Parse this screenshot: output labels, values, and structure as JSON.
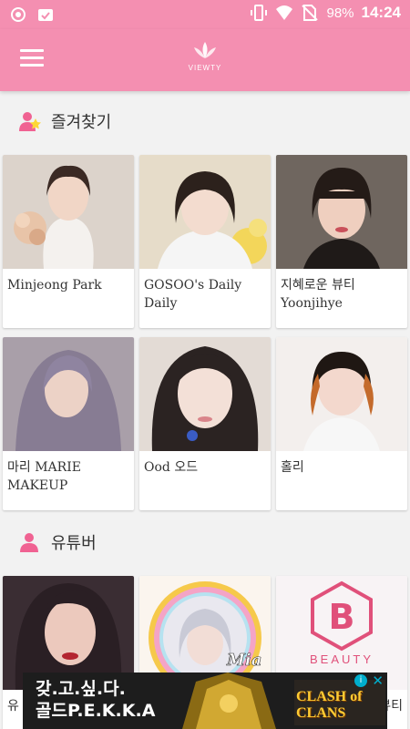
{
  "status_bar": {
    "battery_percent": "98%",
    "time": "14:24"
  },
  "app_bar": {
    "logo_text": "VIEWTY"
  },
  "favorites": {
    "title": "즐겨찾기",
    "items": [
      {
        "name": "Minjeong Park",
        "color": "#c8b6a6"
      },
      {
        "name": "GOSOO's Daily Daily",
        "color": "#b7a28d"
      },
      {
        "name": "지혜로운 뷰티 Yoonjihye",
        "color": "#8d8075"
      },
      {
        "name": "마리 MARIE MAKEUP",
        "color": "#8b8295"
      },
      {
        "name": "Ood 오드",
        "color": "#d8cfc9"
      },
      {
        "name": "홀리",
        "color": "#cfc3bd"
      }
    ]
  },
  "youtubers": {
    "title": "유튜버",
    "items": [
      {
        "name": "유",
        "color": "#3a2d33"
      },
      {
        "name": "",
        "color": "#f4e8d8"
      },
      {
        "name": "뷰티",
        "color": "#f7f2f4"
      }
    ],
    "beauty_logo_letter": "B",
    "beauty_logo_text": "BEAUTY",
    "mia_text": "Mia"
  },
  "ad": {
    "line1": "갖.고.싶.다.",
    "line2": "골드P.E.K.K.A",
    "brand": "CLASH of CLANS",
    "info_icon": "i",
    "close_icon": "✕"
  },
  "colors": {
    "primary": "#f48fb1",
    "beauty_pink": "#e0507a",
    "ad_bg": "#1d1d1d"
  }
}
